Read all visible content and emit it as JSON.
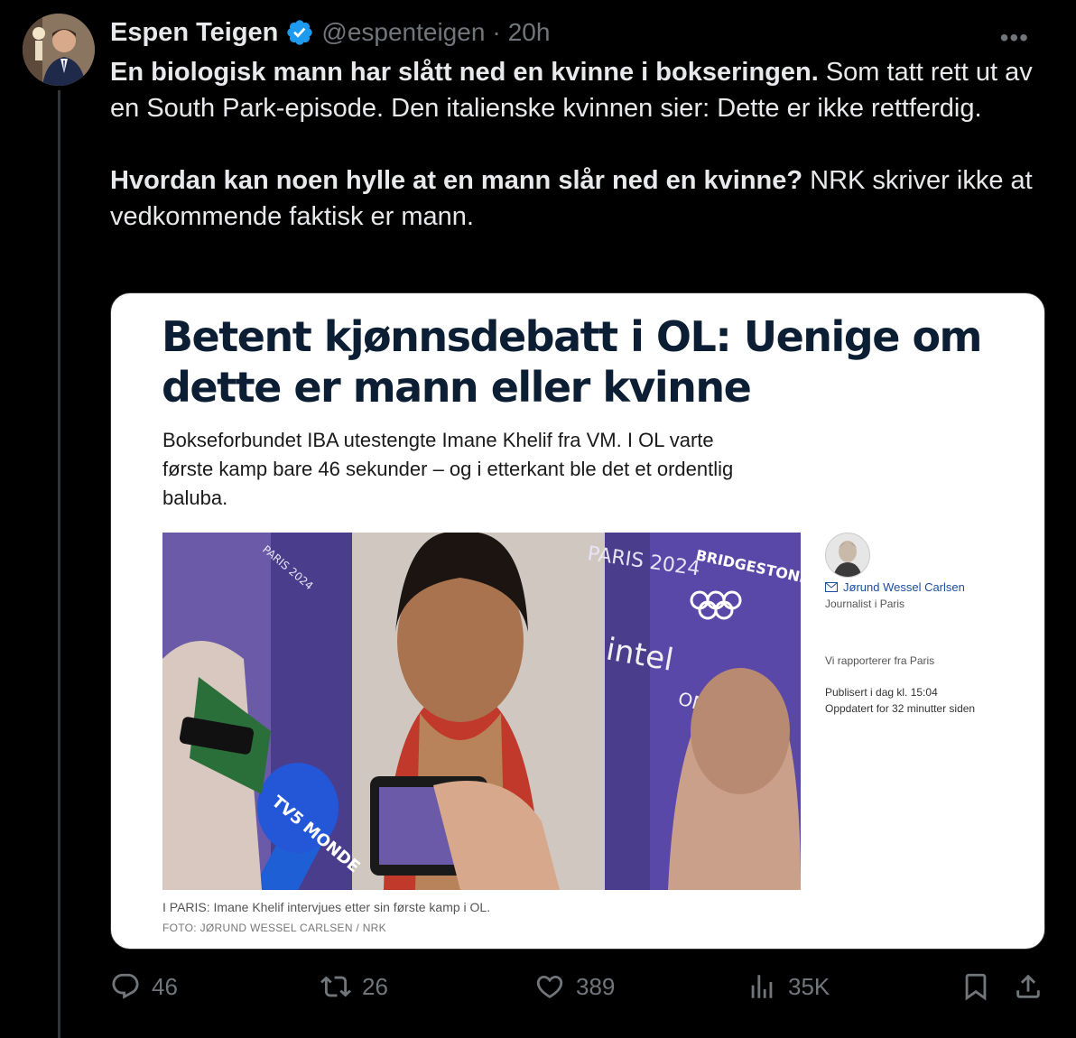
{
  "author": {
    "name": "Espen Teigen",
    "handle": "@espenteigen",
    "separator": "·",
    "time": "20h",
    "verified": true
  },
  "more_icon": "•••",
  "tweet": {
    "p1_bold": "En biologisk mann har slått ned en kvinne i bokseringen.",
    "p1_rest": " Som tatt rett ut av en South Park-episode. Den italienske kvinnen sier: Dette er ikke rettferdig.",
    "p2_bold": "Hvordan kan noen hylle at en mann slår ned en kvinne?",
    "p2_rest": " NRK skriver ikke at vedkommende faktisk er mann."
  },
  "article": {
    "headline": "Betent kjønnsdebatt i OL: Uenige om dette er mann eller kvinne",
    "lead": "Bokseforbundet IBA utestengte Imane Khelif fra VM. I OL varte første kamp bare 46 sekunder – og i etterkant ble det et ordentlig baluba.",
    "photo_texts": {
      "paris": "PARIS 2024",
      "bridgestone": "BRIDGESTONE",
      "intel": "intel",
      "omega": "OMEGA",
      "tv5": "TV5 MONDE"
    },
    "caption": "I PARIS: Imane Khelif intervjues etter sin første kamp i OL.",
    "credit": "FOTO: JØRUND WESSEL CARLSEN / NRK",
    "byline_name": "Jørund Wessel Carlsen",
    "byline_role": "Journalist i Paris",
    "reports_from": "Vi rapporterer fra Paris",
    "published": "Publisert i dag kl. 15:04",
    "updated": "Oppdatert for 32 minutter siden"
  },
  "actions": {
    "replies": "46",
    "reposts": "26",
    "likes": "389",
    "views": "35K"
  },
  "colors": {
    "background": "#000000",
    "text": "#e7e9ea",
    "muted": "#71767b",
    "verified_blue": "#1d9bf0",
    "headline_navy": "#0b1e33"
  }
}
